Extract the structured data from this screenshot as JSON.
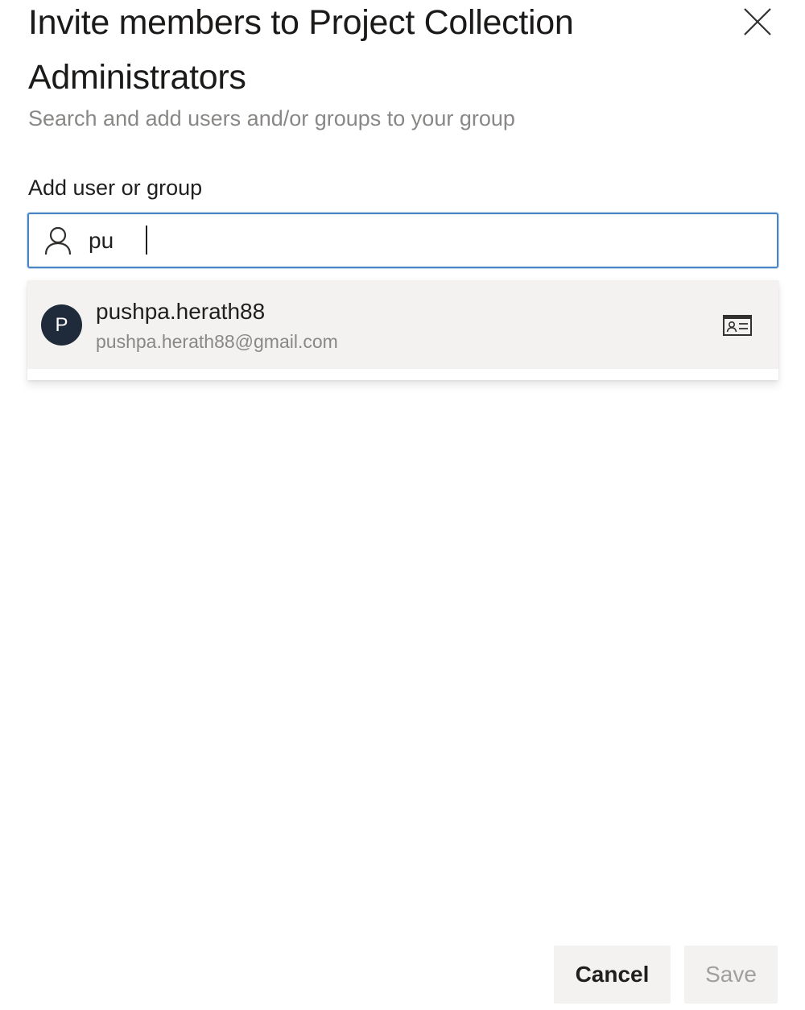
{
  "dialog": {
    "title": "Invite members to Project Collection Administrators",
    "subtitle": "Search and add users and/or groups to your group",
    "close_icon": "close-icon"
  },
  "field": {
    "label": "Add user or group",
    "value": "pu",
    "icon": "person-icon"
  },
  "suggestions": [
    {
      "avatar_initial": "P",
      "name": "pushpa.herath88",
      "email": "pushpa.herath88@gmail.com",
      "action_icon": "contact-card-icon"
    }
  ],
  "buttons": {
    "cancel_label": "Cancel",
    "save_label": "Save",
    "save_enabled": false
  },
  "colors": {
    "focus_border": "#4a86c5",
    "avatar_bg": "#1f2a3a",
    "button_bg": "#f3f2f1",
    "disabled_text": "#a19f9d"
  }
}
